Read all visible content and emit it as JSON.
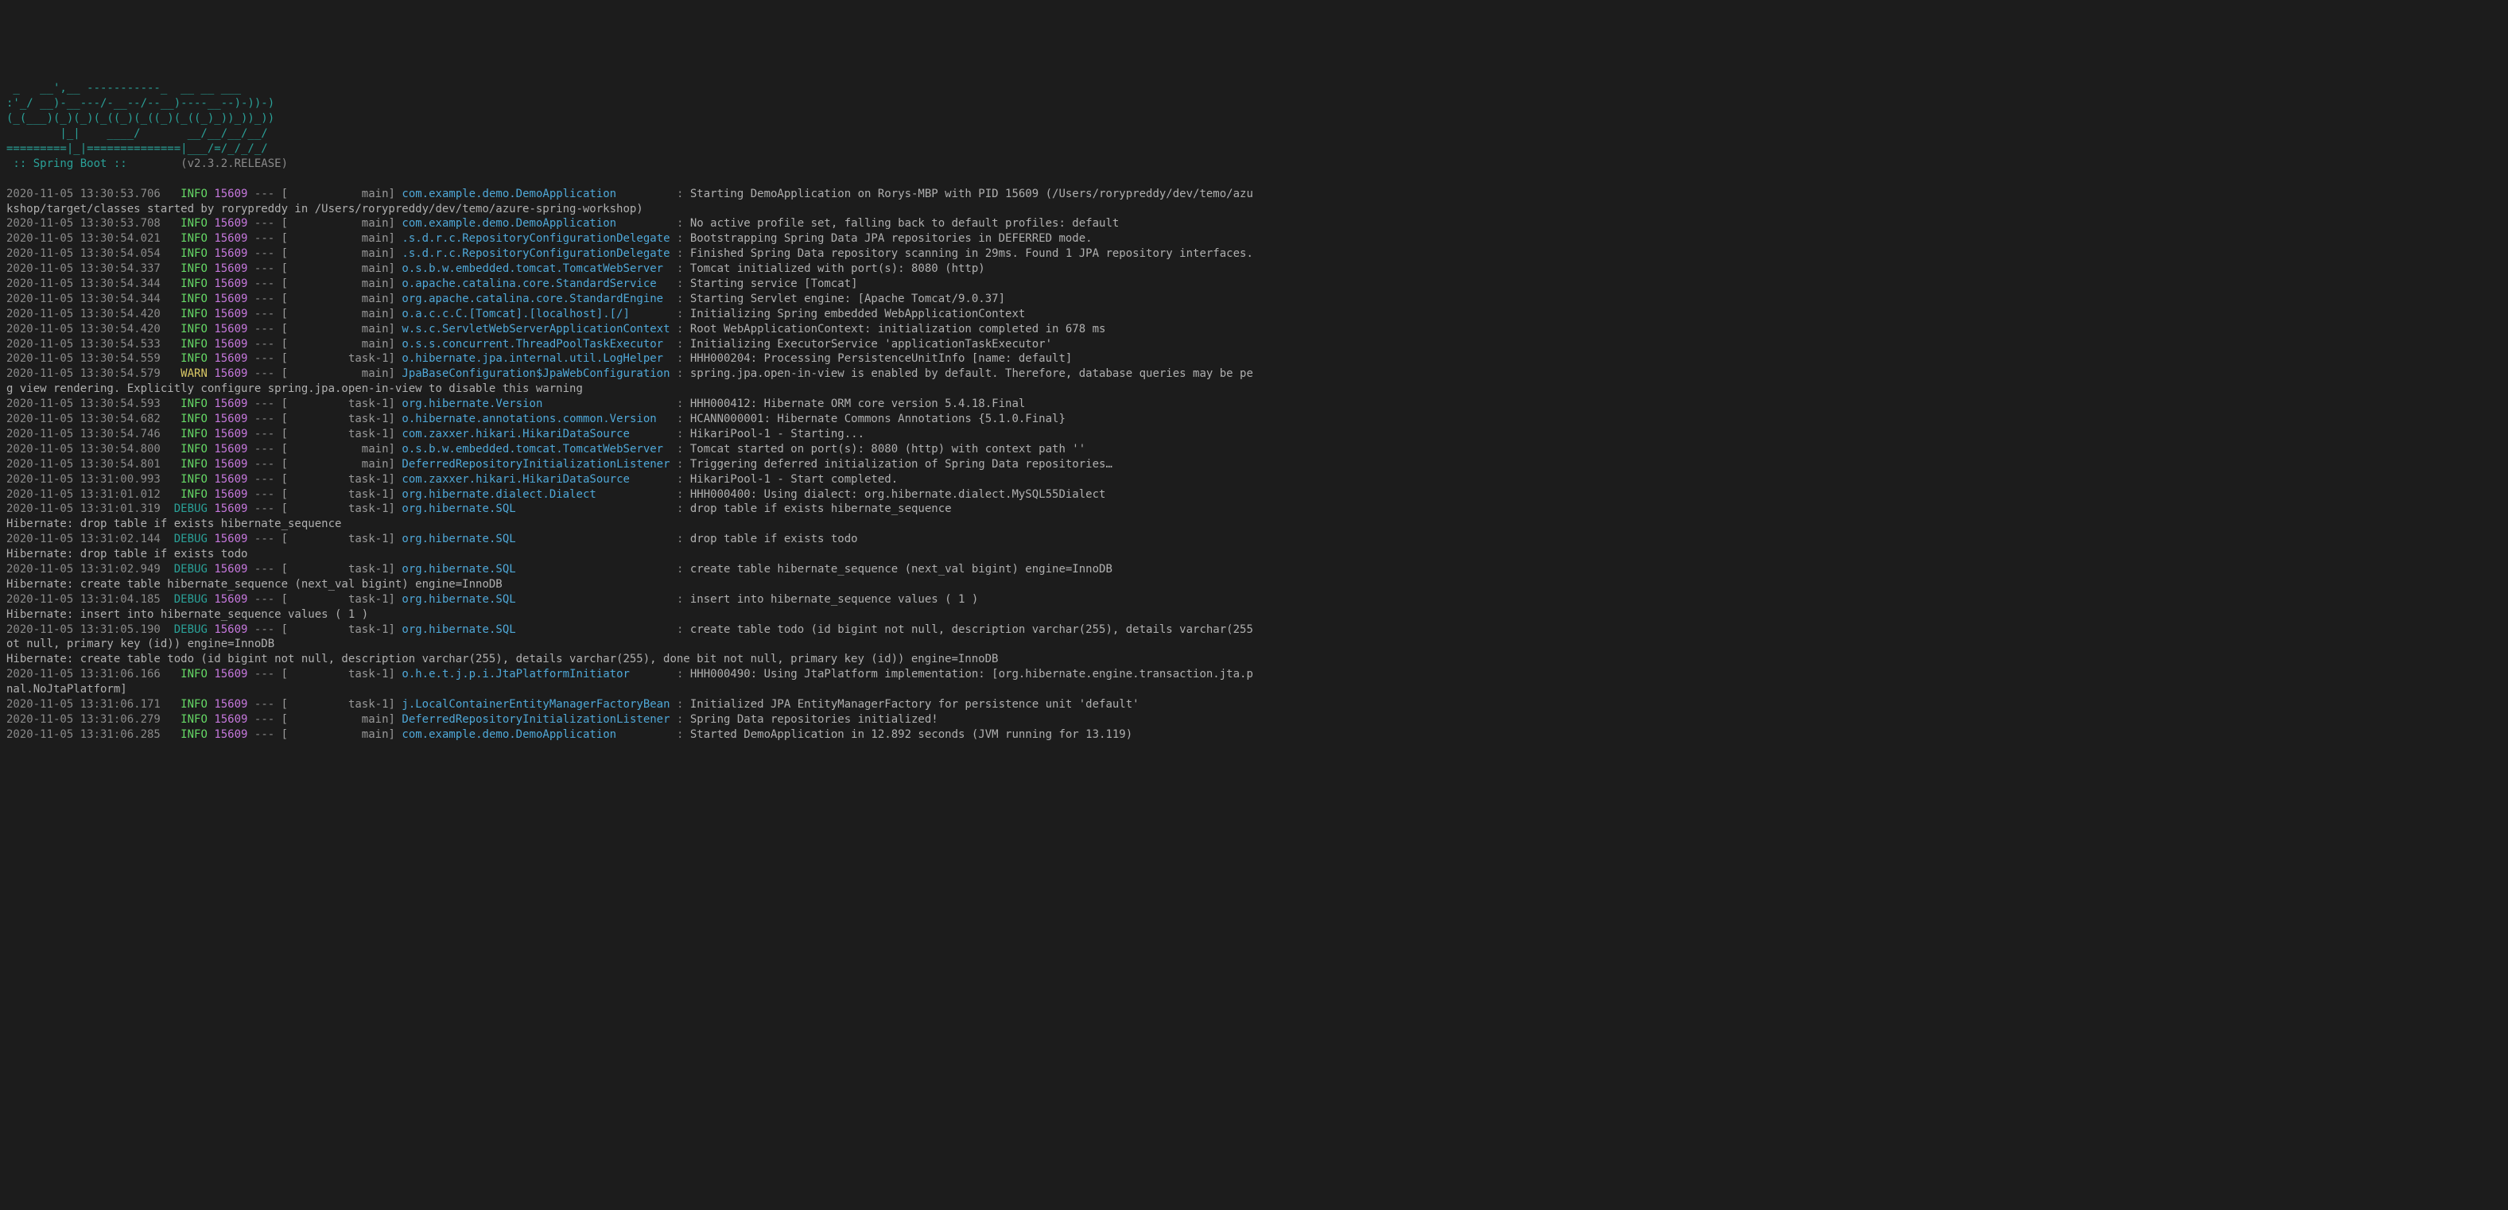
{
  "banner": {
    "art": " _   __',__ -----------_  __ __ ___\n:'_/ __)-__---/-__--/--__)----__--)-))-)\n(_(___)(_)(_)(_((_)(_((_)(_((_)_))_))_))\n        |_|    ____/       __/__/__/__/\n=========|_|==============|___/=/_/_/_/",
    "boot_line": " :: Spring Boot ::        ",
    "version": "(v2.3.2.RELEASE)"
  },
  "entries": [
    {
      "ts": "2020-11-05 13:30:53.706",
      "level": "INFO",
      "pid": "15609",
      "thread": "main",
      "logger": "com.example.demo.DemoApplication",
      "msg": "Starting DemoApplication on Rorys-MBP with PID 15609 (/Users/rorypreddy/dev/temo/azu"
    },
    {
      "wrap": "kshop/target/classes started by rorypreddy in /Users/rorypreddy/dev/temo/azure-spring-workshop)"
    },
    {
      "ts": "2020-11-05 13:30:53.708",
      "level": "INFO",
      "pid": "15609",
      "thread": "main",
      "logger": "com.example.demo.DemoApplication",
      "msg": "No active profile set, falling back to default profiles: default"
    },
    {
      "ts": "2020-11-05 13:30:54.021",
      "level": "INFO",
      "pid": "15609",
      "thread": "main",
      "logger": ".s.d.r.c.RepositoryConfigurationDelegate",
      "msg": "Bootstrapping Spring Data JPA repositories in DEFERRED mode."
    },
    {
      "ts": "2020-11-05 13:30:54.054",
      "level": "INFO",
      "pid": "15609",
      "thread": "main",
      "logger": ".s.d.r.c.RepositoryConfigurationDelegate",
      "msg": "Finished Spring Data repository scanning in 29ms. Found 1 JPA repository interfaces."
    },
    {
      "ts": "2020-11-05 13:30:54.337",
      "level": "INFO",
      "pid": "15609",
      "thread": "main",
      "logger": "o.s.b.w.embedded.tomcat.TomcatWebServer",
      "msg": "Tomcat initialized with port(s): 8080 (http)"
    },
    {
      "ts": "2020-11-05 13:30:54.344",
      "level": "INFO",
      "pid": "15609",
      "thread": "main",
      "logger": "o.apache.catalina.core.StandardService",
      "msg": "Starting service [Tomcat]"
    },
    {
      "ts": "2020-11-05 13:30:54.344",
      "level": "INFO",
      "pid": "15609",
      "thread": "main",
      "logger": "org.apache.catalina.core.StandardEngine",
      "msg": "Starting Servlet engine: [Apache Tomcat/9.0.37]"
    },
    {
      "ts": "2020-11-05 13:30:54.420",
      "level": "INFO",
      "pid": "15609",
      "thread": "main",
      "logger": "o.a.c.c.C.[Tomcat].[localhost].[/]",
      "msg": "Initializing Spring embedded WebApplicationContext"
    },
    {
      "ts": "2020-11-05 13:30:54.420",
      "level": "INFO",
      "pid": "15609",
      "thread": "main",
      "logger": "w.s.c.ServletWebServerApplicationContext",
      "msg": "Root WebApplicationContext: initialization completed in 678 ms"
    },
    {
      "ts": "2020-11-05 13:30:54.533",
      "level": "INFO",
      "pid": "15609",
      "thread": "main",
      "logger": "o.s.s.concurrent.ThreadPoolTaskExecutor",
      "msg": "Initializing ExecutorService 'applicationTaskExecutor'"
    },
    {
      "ts": "2020-11-05 13:30:54.559",
      "level": "INFO",
      "pid": "15609",
      "thread": "task-1",
      "logger": "o.hibernate.jpa.internal.util.LogHelper",
      "msg": "HHH000204: Processing PersistenceUnitInfo [name: default]"
    },
    {
      "ts": "2020-11-05 13:30:54.579",
      "level": "WARN",
      "pid": "15609",
      "thread": "main",
      "logger": "JpaBaseConfiguration$JpaWebConfiguration",
      "msg": "spring.jpa.open-in-view is enabled by default. Therefore, database queries may be pe"
    },
    {
      "wrap": "g view rendering. Explicitly configure spring.jpa.open-in-view to disable this warning"
    },
    {
      "ts": "2020-11-05 13:30:54.593",
      "level": "INFO",
      "pid": "15609",
      "thread": "task-1",
      "logger": "org.hibernate.Version",
      "msg": "HHH000412: Hibernate ORM core version 5.4.18.Final"
    },
    {
      "ts": "2020-11-05 13:30:54.682",
      "level": "INFO",
      "pid": "15609",
      "thread": "task-1",
      "logger": "o.hibernate.annotations.common.Version",
      "msg": "HCANN000001: Hibernate Commons Annotations {5.1.0.Final}"
    },
    {
      "ts": "2020-11-05 13:30:54.746",
      "level": "INFO",
      "pid": "15609",
      "thread": "task-1",
      "logger": "com.zaxxer.hikari.HikariDataSource",
      "msg": "HikariPool-1 - Starting..."
    },
    {
      "ts": "2020-11-05 13:30:54.800",
      "level": "INFO",
      "pid": "15609",
      "thread": "main",
      "logger": "o.s.b.w.embedded.tomcat.TomcatWebServer",
      "msg": "Tomcat started on port(s): 8080 (http) with context path ''"
    },
    {
      "ts": "2020-11-05 13:30:54.801",
      "level": "INFO",
      "pid": "15609",
      "thread": "main",
      "logger": "DeferredRepositoryInitializationListener",
      "msg": "Triggering deferred initialization of Spring Data repositories…"
    },
    {
      "ts": "2020-11-05 13:31:00.993",
      "level": "INFO",
      "pid": "15609",
      "thread": "task-1",
      "logger": "com.zaxxer.hikari.HikariDataSource",
      "msg": "HikariPool-1 - Start completed."
    },
    {
      "ts": "2020-11-05 13:31:01.012",
      "level": "INFO",
      "pid": "15609",
      "thread": "task-1",
      "logger": "org.hibernate.dialect.Dialect",
      "msg": "HHH000400: Using dialect: org.hibernate.dialect.MySQL55Dialect"
    },
    {
      "ts": "2020-11-05 13:31:01.319",
      "level": "DEBUG",
      "pid": "15609",
      "thread": "task-1",
      "logger": "org.hibernate.SQL",
      "msg": "drop table if exists hibernate_sequence"
    },
    {
      "wrap": "Hibernate: drop table if exists hibernate_sequence"
    },
    {
      "ts": "2020-11-05 13:31:02.144",
      "level": "DEBUG",
      "pid": "15609",
      "thread": "task-1",
      "logger": "org.hibernate.SQL",
      "msg": "drop table if exists todo"
    },
    {
      "wrap": "Hibernate: drop table if exists todo"
    },
    {
      "ts": "2020-11-05 13:31:02.949",
      "level": "DEBUG",
      "pid": "15609",
      "thread": "task-1",
      "logger": "org.hibernate.SQL",
      "msg": "create table hibernate_sequence (next_val bigint) engine=InnoDB"
    },
    {
      "wrap": "Hibernate: create table hibernate_sequence (next_val bigint) engine=InnoDB"
    },
    {
      "ts": "2020-11-05 13:31:04.185",
      "level": "DEBUG",
      "pid": "15609",
      "thread": "task-1",
      "logger": "org.hibernate.SQL",
      "msg": "insert into hibernate_sequence values ( 1 )"
    },
    {
      "wrap": "Hibernate: insert into hibernate_sequence values ( 1 )"
    },
    {
      "ts": "2020-11-05 13:31:05.190",
      "level": "DEBUG",
      "pid": "15609",
      "thread": "task-1",
      "logger": "org.hibernate.SQL",
      "msg": "create table todo (id bigint not null, description varchar(255), details varchar(255"
    },
    {
      "wrap": "ot null, primary key (id)) engine=InnoDB"
    },
    {
      "wrap": "Hibernate: create table todo (id bigint not null, description varchar(255), details varchar(255), done bit not null, primary key (id)) engine=InnoDB"
    },
    {
      "ts": "2020-11-05 13:31:06.166",
      "level": "INFO",
      "pid": "15609",
      "thread": "task-1",
      "logger": "o.h.e.t.j.p.i.JtaPlatformInitiator",
      "msg": "HHH000490: Using JtaPlatform implementation: [org.hibernate.engine.transaction.jta.p"
    },
    {
      "wrap": "nal.NoJtaPlatform]"
    },
    {
      "ts": "2020-11-05 13:31:06.171",
      "level": "INFO",
      "pid": "15609",
      "thread": "task-1",
      "logger": "j.LocalContainerEntityManagerFactoryBean",
      "msg": "Initialized JPA EntityManagerFactory for persistence unit 'default'"
    },
    {
      "ts": "2020-11-05 13:31:06.279",
      "level": "INFO",
      "pid": "15609",
      "thread": "main",
      "logger": "DeferredRepositoryInitializationListener",
      "msg": "Spring Data repositories initialized!"
    },
    {
      "ts": "2020-11-05 13:31:06.285",
      "level": "INFO",
      "pid": "15609",
      "thread": "main",
      "logger": "com.example.demo.DemoApplication",
      "msg": "Started DemoApplication in 12.892 seconds (JVM running for 13.119)"
    }
  ]
}
